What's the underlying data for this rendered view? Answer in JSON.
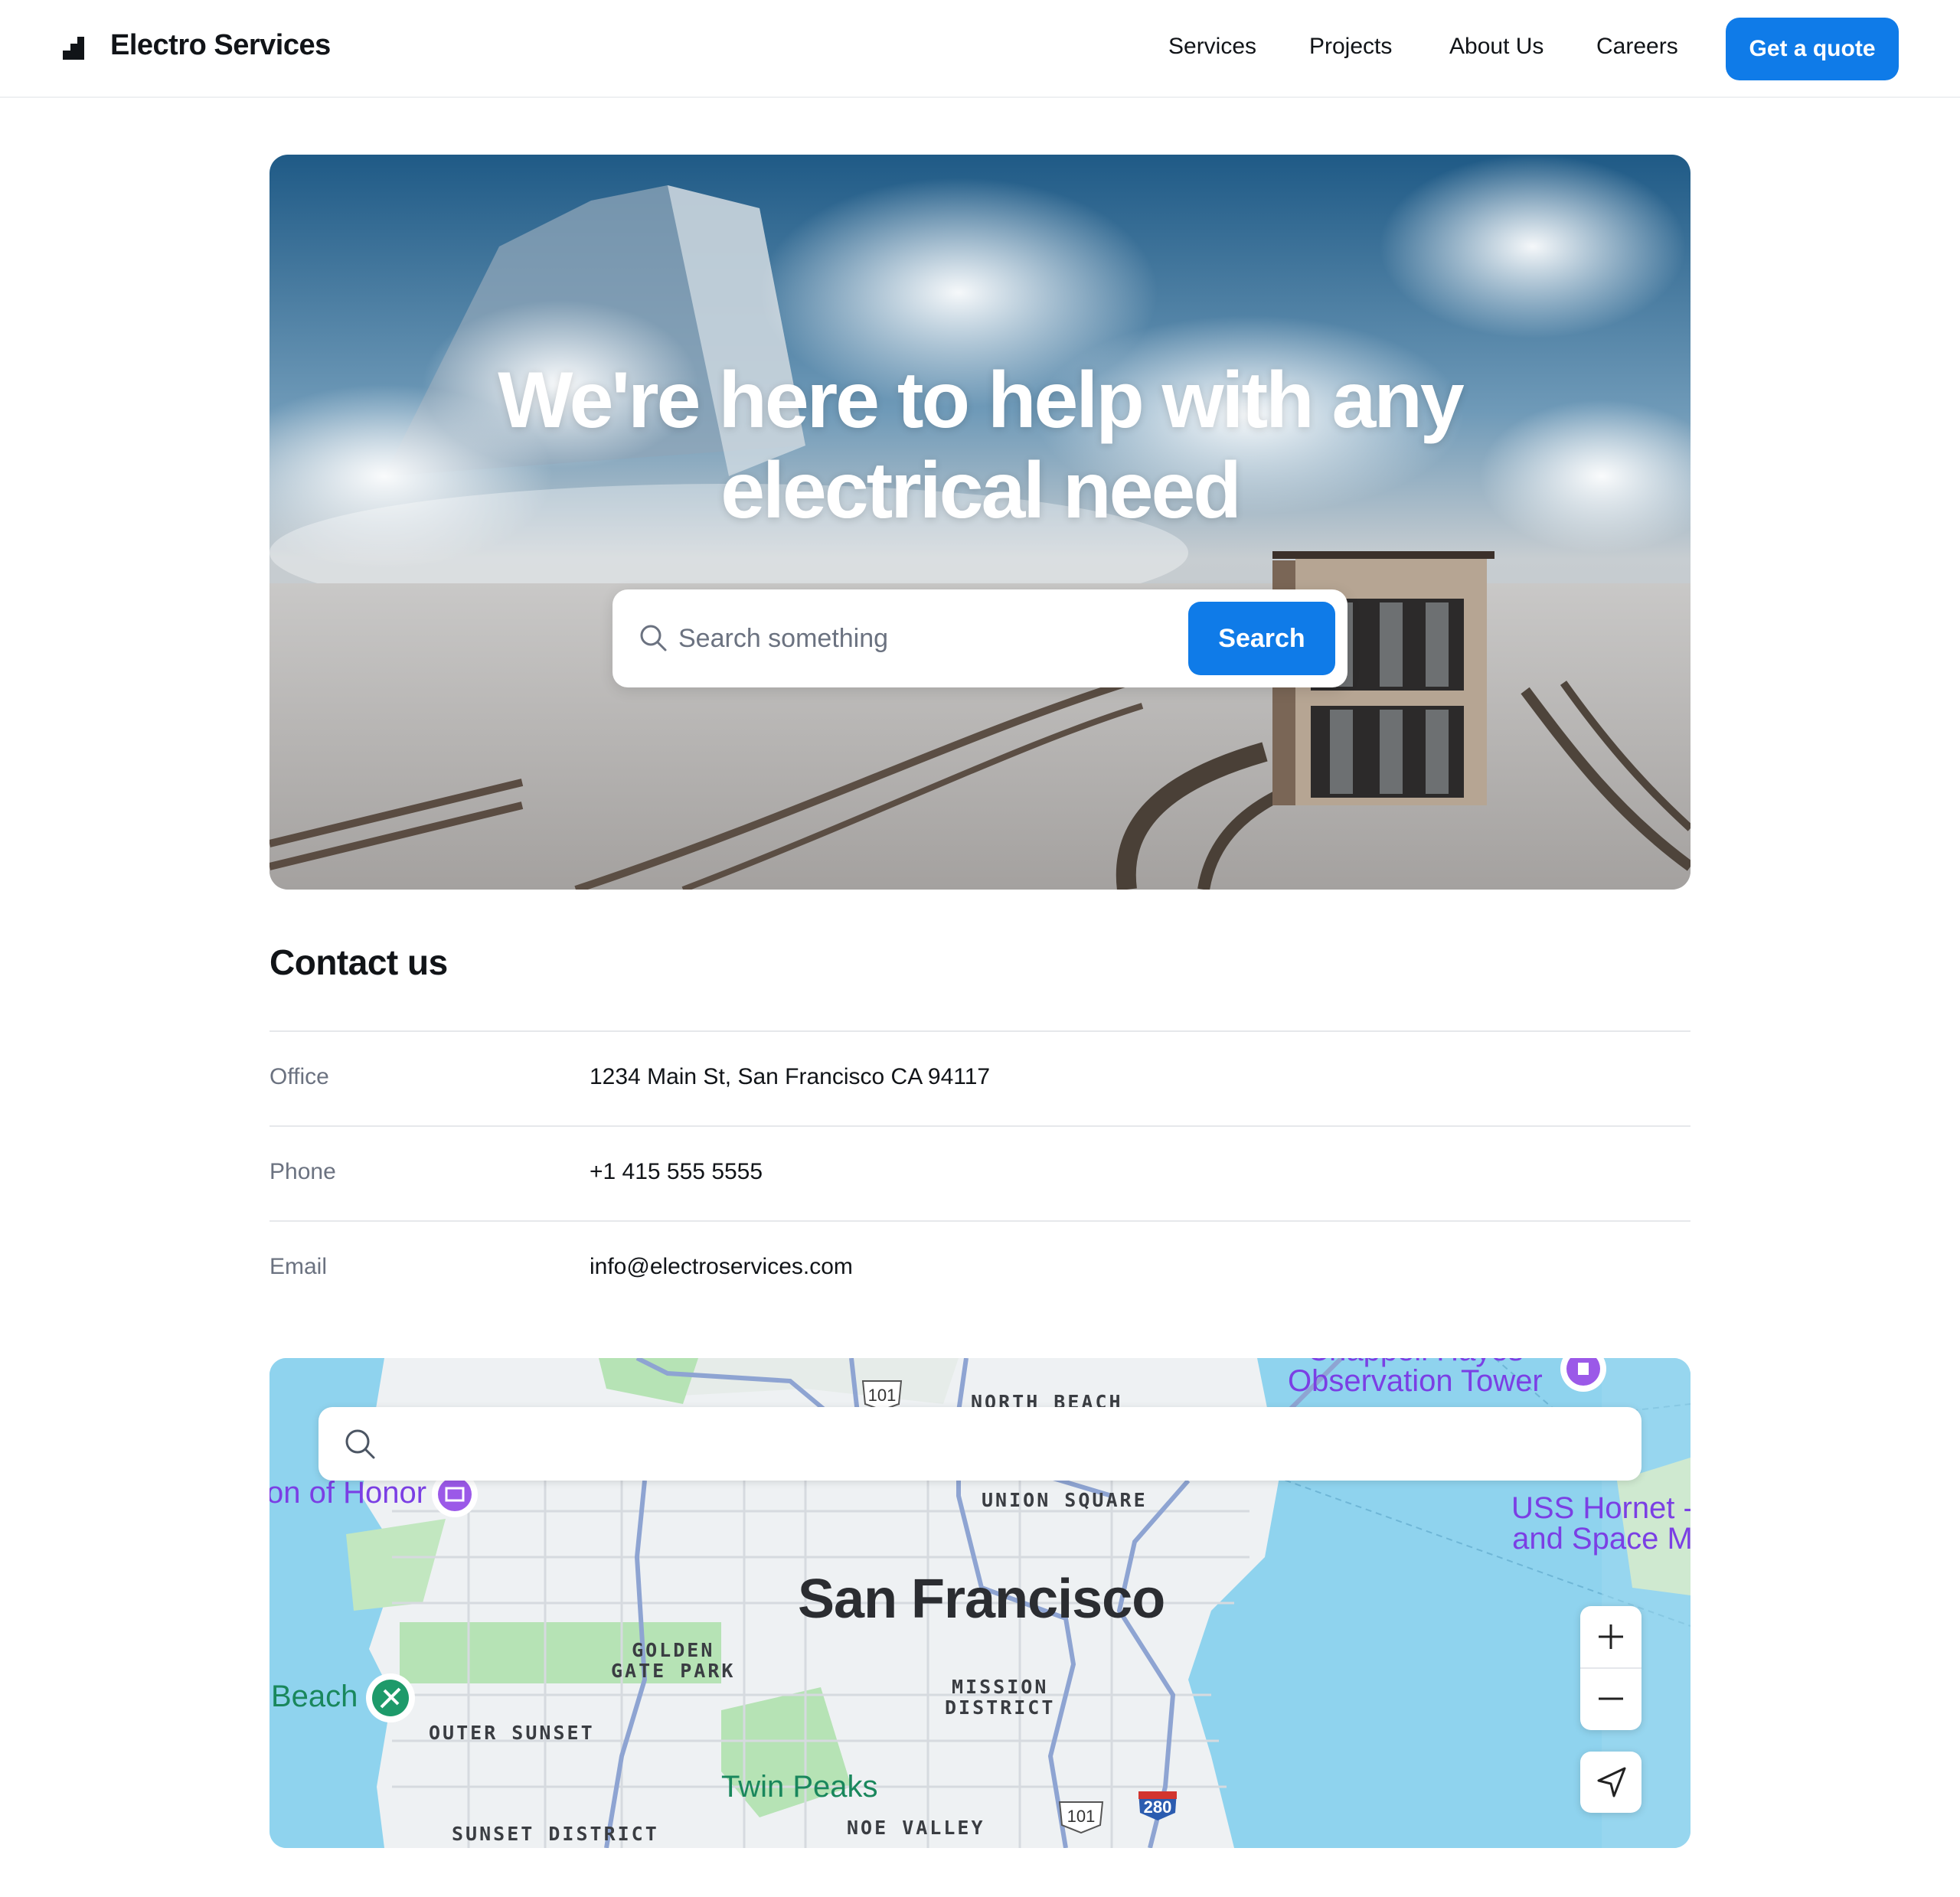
{
  "header": {
    "brand": "Electro Services",
    "nav": [
      "Services",
      "Projects",
      "About Us",
      "Careers"
    ],
    "cta_label": "Get a quote"
  },
  "hero": {
    "title": "We're here to help with any electrical need",
    "search_placeholder": "Search something",
    "search_button": "Search"
  },
  "contact": {
    "title": "Contact us",
    "rows": [
      {
        "label": "Office",
        "value": "1234 Main St, San Francisco CA 94117"
      },
      {
        "label": "Phone",
        "value": "+1 415 555 5555"
      },
      {
        "label": "Email",
        "value": "info@electroservices.com"
      }
    ]
  },
  "map": {
    "city": "San Francisco",
    "districts": {
      "north_beach": "NORTH BEACH",
      "union_square": "UNION SQUARE",
      "golden_gate_park": "GOLDEN\nGATE PARK",
      "mission_district": "MISSION\nDISTRICT",
      "outer_sunset": "OUTER SUNSET",
      "sunset_district": "SUNSET DISTRICT",
      "noe_valley": "NOE VALLEY"
    },
    "pois": {
      "observation_tower": "Chappell Hayes\nObservation Tower",
      "legion_of_honor": "on of Honor",
      "uss_hornet": "USS Hornet -\nand Space M",
      "beach": "Beach",
      "twin_peaks": "Twin Peaks"
    },
    "highways": [
      "101",
      "101",
      "280"
    ]
  },
  "colors": {
    "accent": "#0f7be8",
    "text": "#111418",
    "muted": "#6b7280",
    "water": "#8fd3ee",
    "land": "#eef1f3",
    "park": "#b6e3b5",
    "poi_purple": "#9b59e8",
    "poi_green": "#1e9a6a"
  }
}
